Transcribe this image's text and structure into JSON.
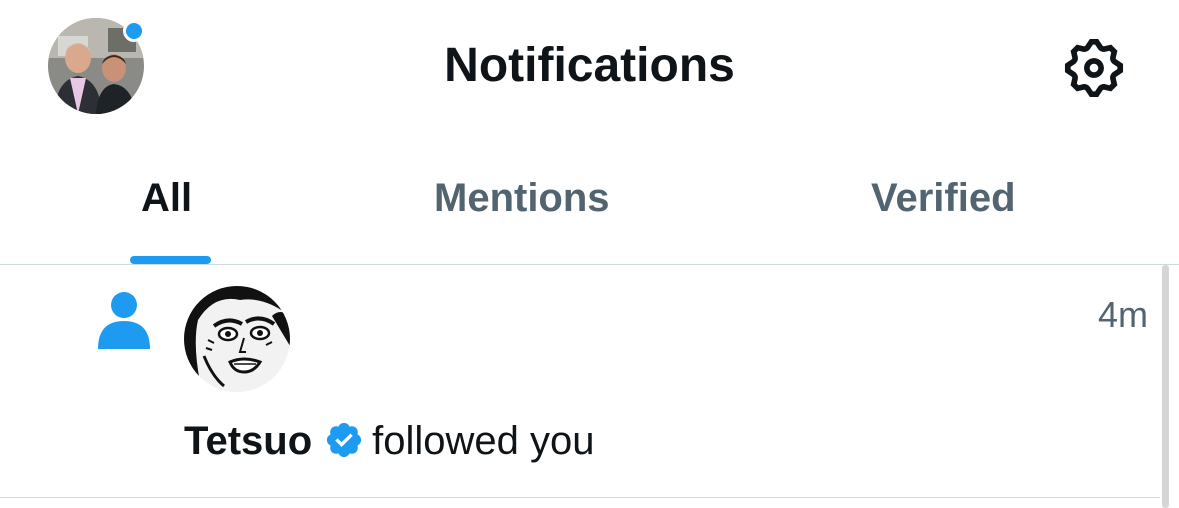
{
  "header": {
    "title": "Notifications",
    "profile_icon": "avatar-photo",
    "settings_icon": "gear-icon",
    "unread_dot_color": "#1d9bf0"
  },
  "tabs": [
    {
      "label": "All",
      "active": true
    },
    {
      "label": "Mentions",
      "active": false
    },
    {
      "label": "Verified",
      "active": false
    }
  ],
  "notifications": [
    {
      "type_icon": "person-icon",
      "user": "Tetsuo",
      "verified": true,
      "action": "followed you",
      "time": "4m"
    }
  ],
  "colors": {
    "accent": "#1d9bf0",
    "text_primary": "#0f1419",
    "text_secondary": "#536471",
    "divider": "#cfd9de"
  }
}
